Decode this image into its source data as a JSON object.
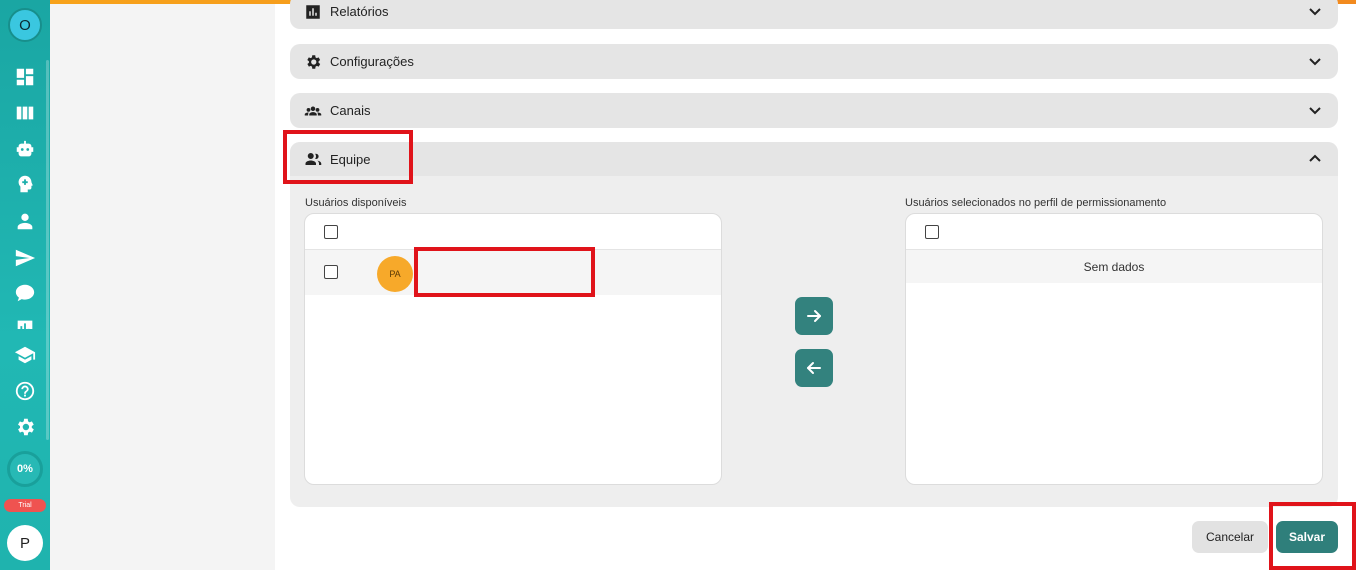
{
  "sidebar": {
    "avatar_top": "O",
    "icons": [
      "dashboard-icon",
      "kanban-icon",
      "robot-icon",
      "brain-icon",
      "person-icon",
      "send-icon",
      "chat-bubble-icon",
      "chart-icon",
      "school-icon",
      "help-icon",
      "gear-icon"
    ],
    "progress": "0%",
    "trial_badge": "Trial",
    "avatar_bottom": "P"
  },
  "accordion": {
    "relatorios": "Relatórios",
    "configuracoes": "Configurações",
    "canais": "Canais",
    "equipe": "Equipe"
  },
  "equipe": {
    "available_label": "Usuários disponíveis",
    "selected_label": "Usuários selecionados no perfil de permissionamento",
    "users": [
      {
        "initials": "PA",
        "name": ""
      }
    ],
    "empty_text": "Sem dados"
  },
  "actions": {
    "cancel": "Cancelar",
    "save": "Salvar"
  },
  "colors": {
    "accent": "#2f7f7b",
    "sidebar": "#1fb3ae",
    "highlight": "#e0131a",
    "avatar": "#f7a92a"
  }
}
